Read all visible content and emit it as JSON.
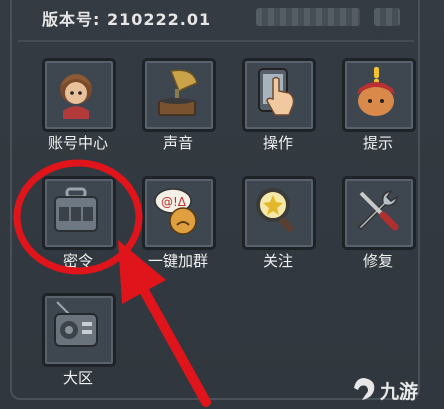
{
  "header": {
    "version": "版本号: 210222.01"
  },
  "menu": [
    {
      "label": "账号中心",
      "icon": "avatar-character-icon"
    },
    {
      "label": "声音",
      "icon": "gramophone-icon"
    },
    {
      "label": "操作",
      "icon": "hand-tap-icon"
    },
    {
      "label": "提示",
      "icon": "hint-character-icon"
    },
    {
      "label": "密令",
      "icon": "code-box-icon"
    },
    {
      "label": "一键加群",
      "icon": "chat-bubble-face-icon"
    },
    {
      "label": "关注",
      "icon": "magnifier-icon"
    },
    {
      "label": "修复",
      "icon": "wrench-screwdriver-icon"
    },
    {
      "label": "大区",
      "icon": "radio-icon"
    }
  ],
  "annotation": {
    "highlight": "red-circle-and-arrow",
    "color": "#e0141b"
  },
  "watermark": {
    "text": "九游"
  },
  "colors": {
    "panel": "#343b42",
    "tile": "#3e4650",
    "annotation": "#e0141b"
  }
}
